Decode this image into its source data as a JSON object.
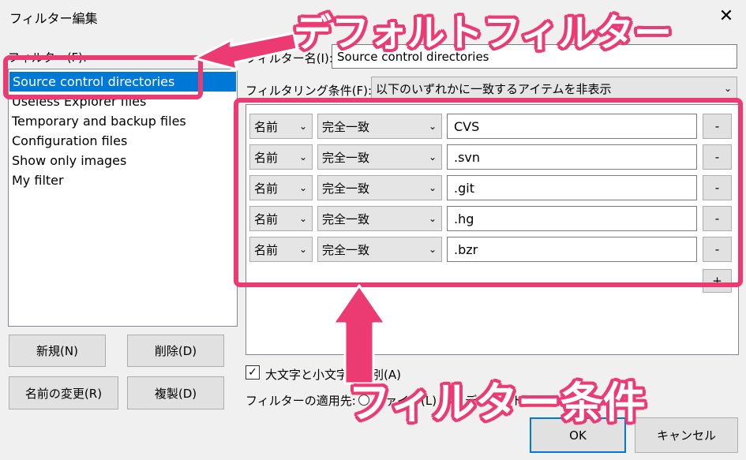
{
  "window": {
    "title": "フィルター編集",
    "close_glyph": "✕"
  },
  "left": {
    "filters_label": "フィルター(F):",
    "filters": [
      "Source control directories",
      "Useless Explorer files",
      "Temporary and backup files",
      "Configuration files",
      "Show only images",
      "My filter"
    ],
    "selected_index": 0,
    "buttons": {
      "new": "新規(N)",
      "delete": "削除(D)",
      "rename": "名前の変更(R)",
      "duplicate": "複製(D)"
    }
  },
  "right": {
    "name_label": "フィルター名(I):",
    "name_value": "Source control directories",
    "condition_label": "フィルタリング条件(F):",
    "condition_value": "以下のいずれかに一致するアイテムを非表示",
    "rules": [
      {
        "property": "名前",
        "operator": "完全一致",
        "value": "CVS",
        "remove": "-"
      },
      {
        "property": "名前",
        "operator": "完全一致",
        "value": ".svn",
        "remove": "-"
      },
      {
        "property": "名前",
        "operator": "完全一致",
        "value": ".git",
        "remove": "-"
      },
      {
        "property": "名前",
        "operator": "完全一致",
        "value": ".hg",
        "remove": "-"
      },
      {
        "property": "名前",
        "operator": "完全一致",
        "value": ".bzr",
        "remove": "-"
      }
    ],
    "add_label": "+",
    "case_sensitive_label": "大文字と小文字を区別(A)",
    "case_sensitive_checked": true,
    "apply_to_label": "フィルターの適用先:",
    "apply_files_label": "ファイル(L)",
    "apply_dirs_label": "ディレクトリ(C)"
  },
  "footer": {
    "ok": "OK",
    "cancel": "キャンセル"
  },
  "annotations": {
    "default_filter": "デフォルトフィルター",
    "filter_conditions": "フィルター条件",
    "accent": "#ec3a72"
  }
}
